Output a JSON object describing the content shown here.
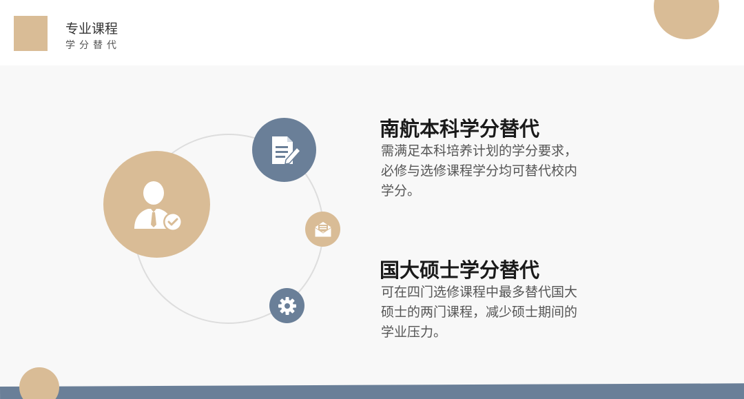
{
  "header": {
    "title": "专业课程",
    "subtitle": "学分替代"
  },
  "sections": [
    {
      "title": "南航本科学分替代",
      "body": "需满足本科培养计划的学分要求，必修与选修课程学分均可替代校内学分。"
    },
    {
      "title": "国大硕士学分替代",
      "body": "可在四门选修课程中最多替代国大硕士的两门课程，减少硕士期间的学业压力。"
    }
  ],
  "icons": {
    "main": "businessman-check-icon",
    "doc": "document-edit-icon",
    "mail": "envelope-open-icon",
    "gear": "gear-icon"
  },
  "colors": {
    "tan": "#d9bc96",
    "slate": "#6a7f98"
  }
}
